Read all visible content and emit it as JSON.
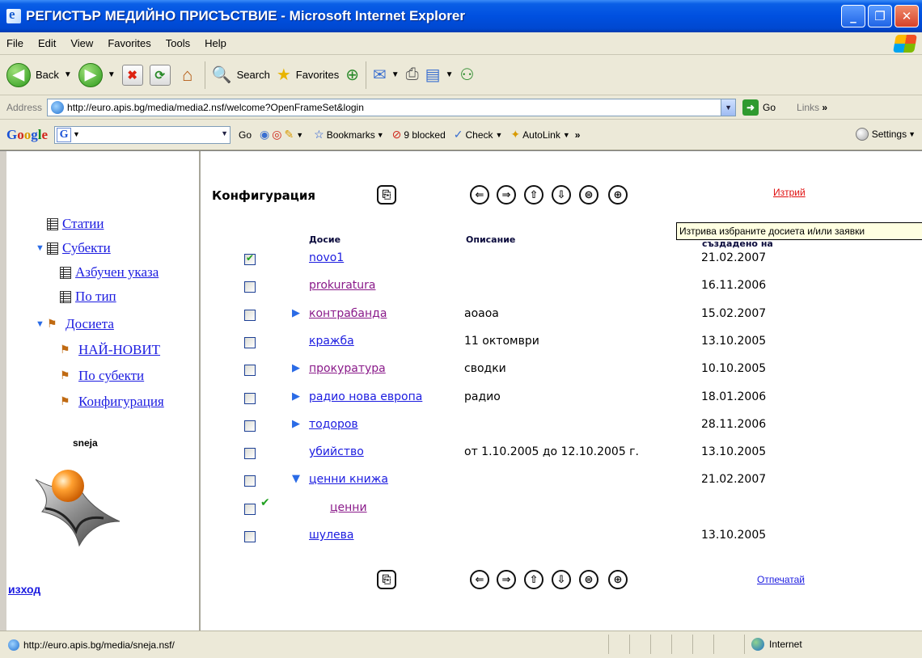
{
  "window": {
    "title": "РЕГИСТЪР МЕДИЙНО ПРИСЪСТВИЕ - Microsoft Internet Explorer",
    "minimize": "_",
    "maximize": "❐",
    "close": "✕"
  },
  "menu": [
    "File",
    "Edit",
    "View",
    "Favorites",
    "Tools",
    "Help"
  ],
  "toolbar": {
    "back_label": "Back",
    "search_label": "Search",
    "favorites_label": "Favorites"
  },
  "address": {
    "label": "Address",
    "url": "http://euro.apis.bg/media/media2.nsf/welcome?OpenFrameSet&login",
    "go_label": "Go",
    "links_label": "Links"
  },
  "google_bar": {
    "logo": [
      "G",
      "o",
      "o",
      "g",
      "l",
      "e"
    ],
    "go_label": "Go",
    "bookmarks_label": "Bookmarks",
    "blocked_label": "9 blocked",
    "check_label": "Check",
    "autolink_label": "AutoLink",
    "settings_label": "Settings"
  },
  "left_nav": {
    "items": [
      {
        "label": "Статии",
        "type": "view",
        "level": 0,
        "expanded": null
      },
      {
        "label": "Субекти",
        "type": "view",
        "level": 0,
        "expanded": true
      },
      {
        "label": "Азбучен указа",
        "type": "view",
        "level": 1,
        "expanded": null
      },
      {
        "label": "По тип",
        "type": "view",
        "level": 1,
        "expanded": null
      },
      {
        "label": "Досиета",
        "type": "folder",
        "level": 0,
        "expanded": true
      },
      {
        "label": "НАЙ-НОВИТ",
        "type": "folder",
        "level": 1,
        "expanded": null
      },
      {
        "label": "По субекти",
        "type": "folder",
        "level": 1,
        "expanded": null
      },
      {
        "label": "Конфигурация",
        "type": "folder",
        "level": 1,
        "expanded": null
      }
    ],
    "user": "sneja",
    "logout_label": "изход"
  },
  "main": {
    "title": "Конфигурация",
    "delete_label": "Изтрий",
    "print_label": "Отпечатай",
    "tooltip": "Изтрива избраните досиета и/или заявки",
    "columns": {
      "dossier": "Досие",
      "description": "Описание",
      "created": "създадено на"
    },
    "rows": [
      {
        "name": "novo1",
        "description": "",
        "date": "21.02.2007",
        "checked": true,
        "expander": "",
        "indent": 0,
        "visited": false,
        "mark": ""
      },
      {
        "name": "prokuratura",
        "description": "",
        "date": "16.11.2006",
        "checked": false,
        "expander": "",
        "indent": 0,
        "visited": true,
        "mark": ""
      },
      {
        "name": "контрабанда",
        "description": "аоаоа",
        "date": "15.02.2007",
        "checked": false,
        "expander": "right",
        "indent": 0,
        "visited": true,
        "mark": ""
      },
      {
        "name": "кражба",
        "description": "11 октомври",
        "date": "13.10.2005",
        "checked": false,
        "expander": "",
        "indent": 0,
        "visited": false,
        "mark": ""
      },
      {
        "name": "прокуратура",
        "description": "сводки",
        "date": "10.10.2005",
        "checked": false,
        "expander": "right",
        "indent": 0,
        "visited": true,
        "mark": ""
      },
      {
        "name": "радио нова европа",
        "description": "радио",
        "date": "18.01.2006",
        "checked": false,
        "expander": "right",
        "indent": 0,
        "visited": false,
        "mark": ""
      },
      {
        "name": "тодоров",
        "description": "",
        "date": "28.11.2006",
        "checked": false,
        "expander": "right",
        "indent": 0,
        "visited": false,
        "mark": ""
      },
      {
        "name": "убийство",
        "description": "от 1.10.2005 до 12.10.2005 г.",
        "date": "13.10.2005",
        "checked": false,
        "expander": "",
        "indent": 0,
        "visited": false,
        "mark": ""
      },
      {
        "name": "ценни книжа",
        "description": "",
        "date": "21.02.2007",
        "checked": false,
        "expander": "down",
        "indent": 0,
        "visited": false,
        "mark": ""
      },
      {
        "name": "ценни",
        "description": "",
        "date": "",
        "checked": false,
        "expander": "",
        "indent": 1,
        "visited": true,
        "mark": "✔"
      },
      {
        "name": "шулева",
        "description": "",
        "date": "13.10.2005",
        "checked": false,
        "expander": "",
        "indent": 0,
        "visited": false,
        "mark": ""
      }
    ]
  },
  "status": {
    "url": "http://euro.apis.bg/media/sneja.nsf/",
    "zone": "Internet"
  }
}
